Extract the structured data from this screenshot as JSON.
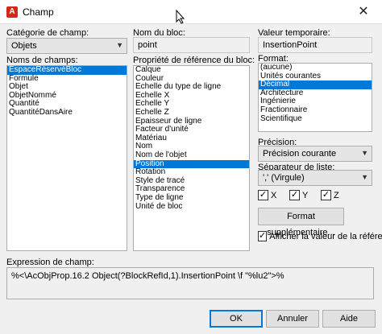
{
  "window": {
    "title": "Champ",
    "app_icon": "A",
    "close_glyph": "✕"
  },
  "field_category": {
    "label": "Catégorie de champ:",
    "value": "Objets"
  },
  "field_names": {
    "label": "Noms de champs:",
    "items": [
      "EspaceRéservéBloc",
      "Formule",
      "Objet",
      "ObjetNommé",
      "Quantité",
      "QuantitéDansAire"
    ],
    "selected_index": 0
  },
  "block_name": {
    "label": "Nom du bloc:",
    "value": "point"
  },
  "ref_property": {
    "label": "Propriété de référence du bloc:",
    "items": [
      "Calque",
      "Couleur",
      "Echelle du type de ligne",
      "Echelle X",
      "Echelle Y",
      "Echelle Z",
      "Epaisseur de ligne",
      "Facteur d'unité",
      "Matériau",
      "Nom",
      "Nom de l'objet",
      "Position",
      "Rotation",
      "Style de tracé",
      "Transparence",
      "Type de ligne",
      "Unité de bloc"
    ],
    "selected_index": 11
  },
  "temp_value": {
    "label": "Valeur temporaire:",
    "value": "InsertionPoint"
  },
  "format": {
    "label": "Format:",
    "items": [
      "(aucune)",
      "Unités courantes",
      "Décimal",
      "Architecture",
      "Ingénierie",
      "Fractionnaire",
      "Scientifique"
    ],
    "selected_index": 2
  },
  "precision": {
    "label": "Précision:",
    "value": "Précision courante"
  },
  "list_separator": {
    "label": "Séparateur de liste:",
    "value": "',' (Virgule)"
  },
  "axes": [
    {
      "label": "X",
      "checked": true
    },
    {
      "label": "Y",
      "checked": true
    },
    {
      "label": "Z",
      "checked": true
    }
  ],
  "additional_format_button": "Format supplémentaire...",
  "show_block_ref_value": {
    "label": "Afficher la valeur de la référence du",
    "checked": true
  },
  "field_expression": {
    "label": "Expression de champ:",
    "value": "%<\\AcObjProp.16.2 Object(?BlockRefId,1).InsertionPoint \\f \"%lu2\">%"
  },
  "buttons": {
    "ok": "OK",
    "cancel": "Annuler",
    "help": "Aide"
  },
  "colors": {
    "selection": "#0078d7",
    "default_button_border": "#0078d7"
  }
}
